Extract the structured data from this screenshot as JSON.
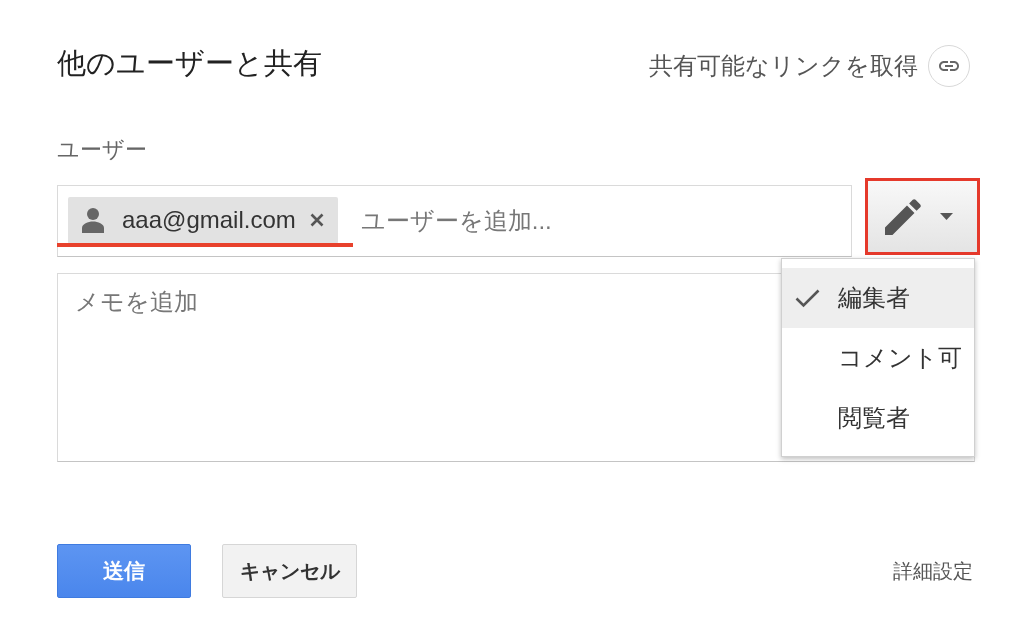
{
  "dialog": {
    "title": "他のユーザーと共有",
    "link_action": "共有可能なリンクを取得"
  },
  "users_label": "ユーザー",
  "recipients": {
    "chips": [
      {
        "email": "aaa@gmail.com",
        "highlighted": true
      }
    ],
    "placeholder": "ユーザーを追加..."
  },
  "permission_button": {
    "highlighted": true
  },
  "permission_menu": {
    "expanded": true,
    "items": [
      {
        "label": "編集者",
        "selected": true
      },
      {
        "label": "コメント可",
        "selected": false
      },
      {
        "label": "閲覧者",
        "selected": false
      }
    ]
  },
  "note": {
    "placeholder": "メモを追加"
  },
  "buttons": [
    {
      "label": "送信",
      "kind": "primary"
    },
    {
      "label": "キャンセル",
      "kind": "secondary"
    }
  ],
  "advanced_link": "詳細設定"
}
